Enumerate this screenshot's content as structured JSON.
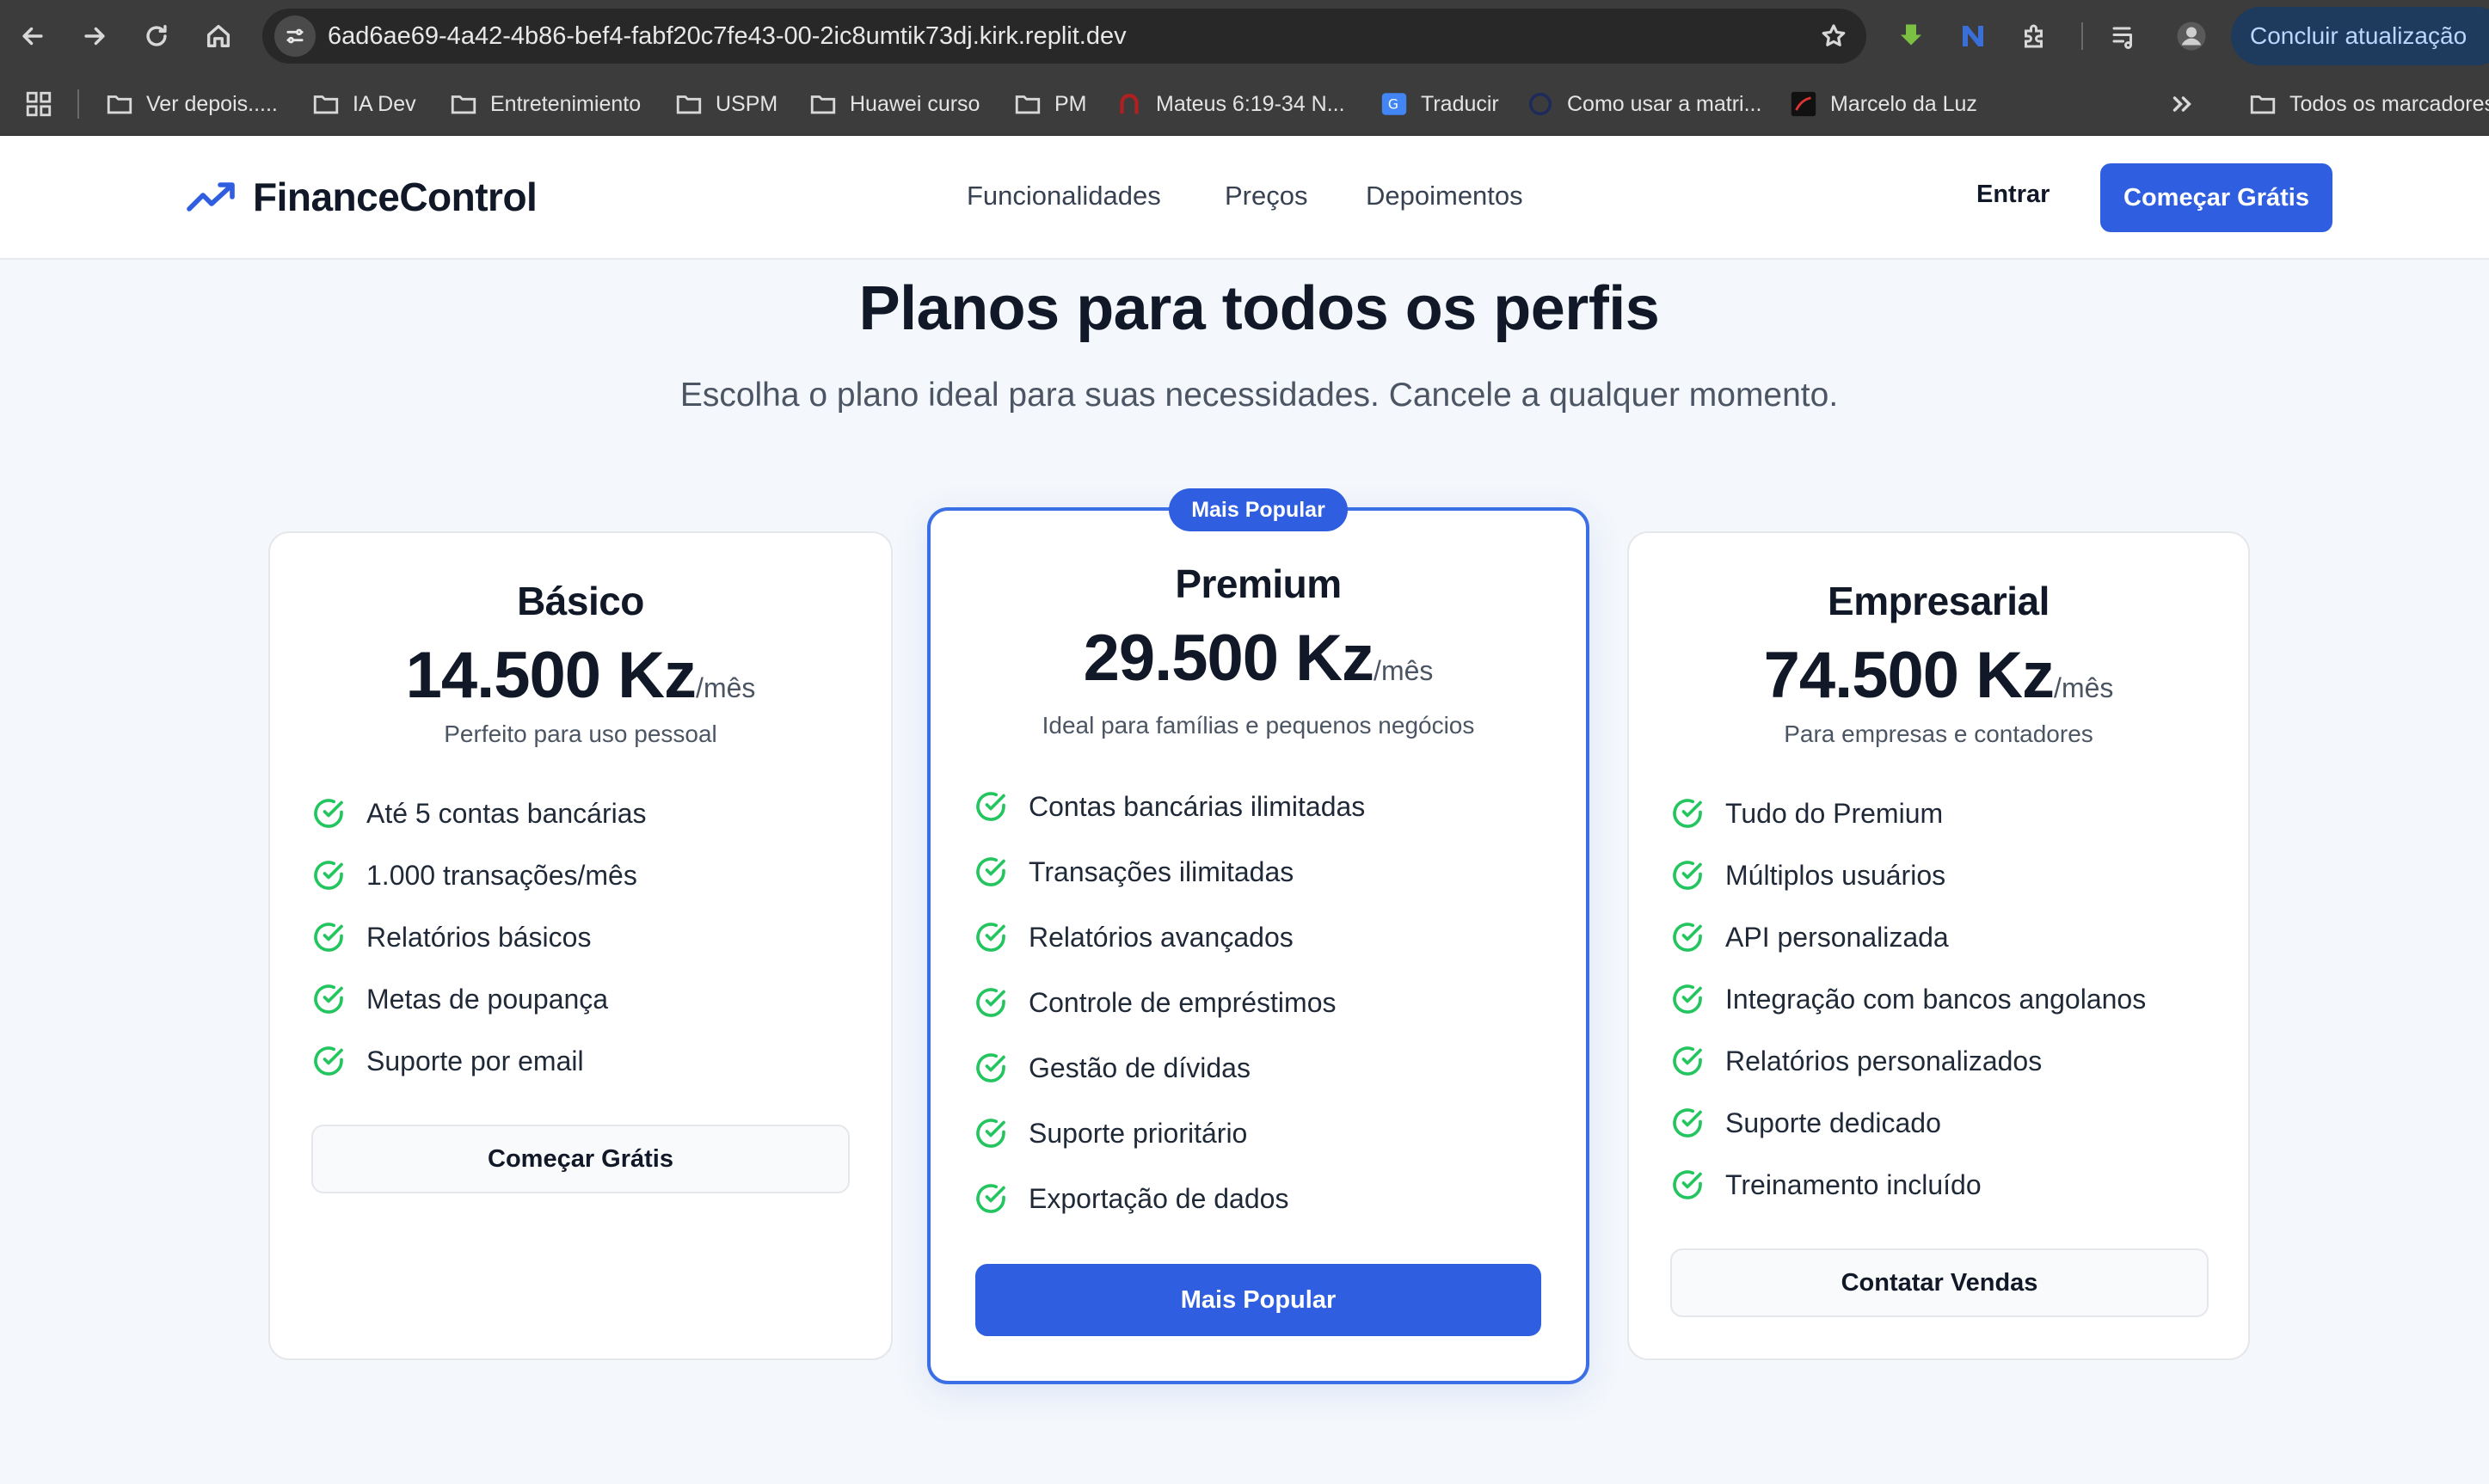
{
  "browser": {
    "url": "6ad6ae69-4a42-4b86-bef4-fabf20c7fe43-00-2ic8umtik73dj.kirk.replit.dev",
    "update_button": "Concluir atualização",
    "bookmarks": [
      {
        "label": "Ver depois.....",
        "icon": "folder-icon"
      },
      {
        "label": "IA Dev",
        "icon": "folder-icon"
      },
      {
        "label": "Entretenimiento",
        "icon": "folder-icon"
      },
      {
        "label": "USPM",
        "icon": "folder-icon"
      },
      {
        "label": "Huawei curso",
        "icon": "folder-icon"
      },
      {
        "label": "PM",
        "icon": "folder-icon"
      },
      {
        "label": "Mateus 6:19-34 N...",
        "icon": "horseshoe-icon"
      },
      {
        "label": "Traducir",
        "icon": "translate-icon"
      },
      {
        "label": "Como usar a matri...",
        "icon": "globe-icon"
      },
      {
        "label": "Marcelo da Luz",
        "icon": "site-favicon-icon"
      }
    ],
    "all_bookmarks": "Todos os marcadores"
  },
  "site": {
    "brand": "FinanceControl",
    "nav": [
      "Funcionalidades",
      "Preços",
      "Depoimentos"
    ],
    "login": "Entrar",
    "cta": "Começar Grátis"
  },
  "pricing": {
    "title": "Planos para todos os perfis",
    "subtitle": "Escolha o plano ideal para suas necessidades. Cancele a qualquer momento.",
    "badge": "Mais Popular",
    "plans": [
      {
        "name": "Básico",
        "price": "14.500 Kz",
        "period": "/mês",
        "description": "Perfeito para uso pessoal",
        "features": [
          "Até 5 contas bancárias",
          "1.000 transações/mês",
          "Relatórios básicos",
          "Metas de poupança",
          "Suporte por email"
        ],
        "button": "Começar Grátis"
      },
      {
        "name": "Premium",
        "price": "29.500 Kz",
        "period": "/mês",
        "description": "Ideal para famílias e pequenos negócios",
        "features": [
          "Contas bancárias ilimitadas",
          "Transações ilimitadas",
          "Relatórios avançados",
          "Controle de empréstimos",
          "Gestão de dívidas",
          "Suporte prioritário",
          "Exportação de dados"
        ],
        "button": "Mais Popular"
      },
      {
        "name": "Empresarial",
        "price": "74.500 Kz",
        "period": "/mês",
        "description": "Para empresas e contadores",
        "features": [
          "Tudo do Premium",
          "Múltiplos usuários",
          "API personalizada",
          "Integração com bancos angolanos",
          "Relatórios personalizados",
          "Suporte dedicado",
          "Treinamento incluído"
        ],
        "button": "Contatar Vendas"
      }
    ]
  },
  "colors": {
    "brand_blue": "#2f5fe0",
    "check_green": "#22c55e",
    "page_bg": "#f4f7fb"
  }
}
